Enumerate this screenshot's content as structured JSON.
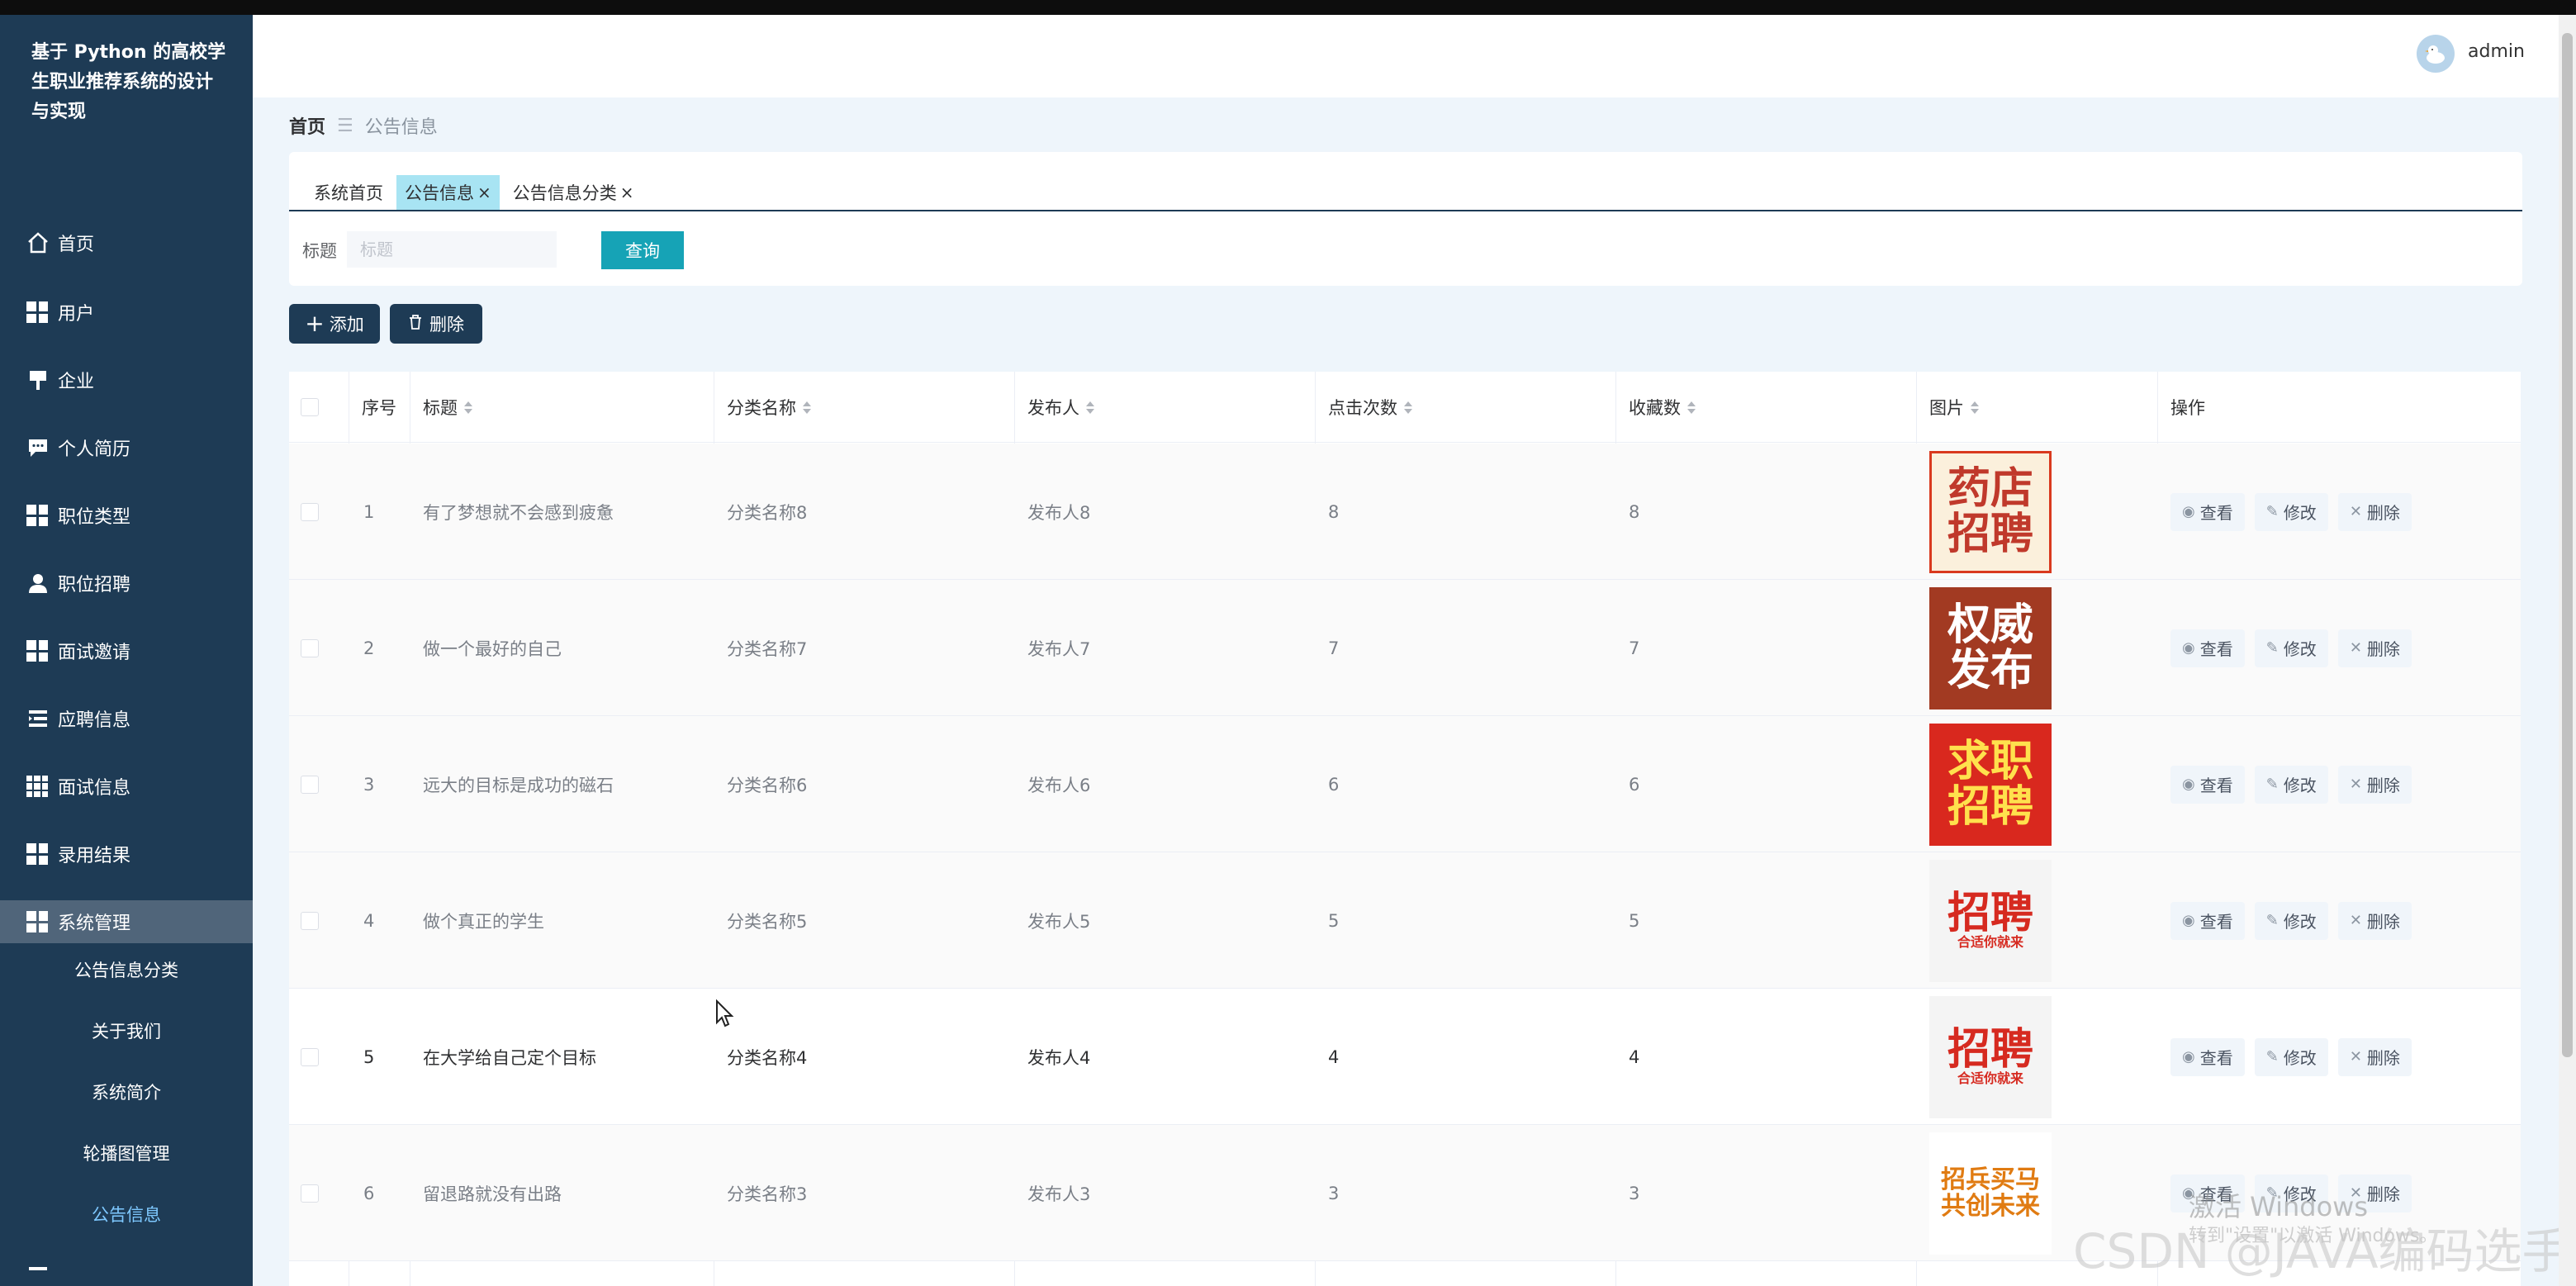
{
  "app": {
    "title": "基于 Python 的高校学生职业推荐系统的设计与实现"
  },
  "user": {
    "name": "admin"
  },
  "sidebar": {
    "items": [
      {
        "label": "首页",
        "icon": "home-icon"
      },
      {
        "label": "用户",
        "icon": "grid-icon"
      },
      {
        "label": "企业",
        "icon": "sign-icon"
      },
      {
        "label": "个人简历",
        "icon": "chat-icon"
      },
      {
        "label": "职位类型",
        "icon": "grid-icon"
      },
      {
        "label": "职位招聘",
        "icon": "person-icon"
      },
      {
        "label": "面试邀请",
        "icon": "grid-icon"
      },
      {
        "label": "应聘信息",
        "icon": "list-icon"
      },
      {
        "label": "面试信息",
        "icon": "grid9-icon"
      },
      {
        "label": "录用结果",
        "icon": "grid-icon"
      },
      {
        "label": "系统管理",
        "icon": "grid-icon"
      }
    ],
    "sub_items": [
      {
        "label": "公告信息分类"
      },
      {
        "label": "关于我们"
      },
      {
        "label": "系统简介"
      },
      {
        "label": "轮播图管理"
      },
      {
        "label": "公告信息"
      }
    ]
  },
  "breadcrumb": {
    "home": "首页",
    "current": "公告信息"
  },
  "tabs": [
    {
      "label": "系统首页",
      "closable": false
    },
    {
      "label": "公告信息",
      "closable": true,
      "active": true
    },
    {
      "label": "公告信息分类",
      "closable": true
    }
  ],
  "filter": {
    "label": "标题",
    "placeholder": "标题",
    "query_label": "查询"
  },
  "toolbar": {
    "add_label": "添加",
    "delete_label": "删除"
  },
  "table": {
    "columns": [
      "序号",
      "标题",
      "分类名称",
      "发布人",
      "点击次数",
      "收藏数",
      "图片",
      "操作"
    ],
    "rows": [
      {
        "no": "1",
        "title": "有了梦想就不会感到疲惫",
        "category": "分类名称8",
        "publisher": "发布人8",
        "clicks": "8",
        "favorites": "8",
        "image": {
          "line1": "药店",
          "line2": "招聘",
          "bg": "#fbf0dc",
          "fg": "#c0392b",
          "border": "#d9391e"
        }
      },
      {
        "no": "2",
        "title": "做一个最好的自己",
        "category": "分类名称7",
        "publisher": "发布人7",
        "clicks": "7",
        "favorites": "7",
        "image": {
          "line1": "权威",
          "line2": "发布",
          "bg": "#a23a22",
          "fg": "#ffffff",
          "border": "#a23a22"
        }
      },
      {
        "no": "3",
        "title": "远大的目标是成功的磁石",
        "category": "分类名称6",
        "publisher": "发布人6",
        "clicks": "6",
        "favorites": "6",
        "image": {
          "line1": "求职",
          "line2": "招聘",
          "bg": "#d9281e",
          "fg": "#ffe14d",
          "border": "#d9281e"
        }
      },
      {
        "no": "4",
        "title": "做个真正的学生",
        "category": "分类名称5",
        "publisher": "发布人5",
        "clicks": "5",
        "favorites": "5",
        "image": {
          "line1": "招聘",
          "line2": "合适你就来",
          "bg": "#f4f4f4",
          "fg": "#d62a20",
          "border": "#f4f4f4"
        }
      },
      {
        "no": "5",
        "title": "在大学给自己定个目标",
        "category": "分类名称4",
        "publisher": "发布人4",
        "clicks": "4",
        "favorites": "4",
        "image": {
          "line1": "招聘",
          "line2": "合适你就来",
          "bg": "#f4f4f4",
          "fg": "#d62a20",
          "border": "#f4f4f4"
        }
      },
      {
        "no": "6",
        "title": "留退路就没有出路",
        "category": "分类名称3",
        "publisher": "发布人3",
        "clicks": "3",
        "favorites": "3",
        "image": {
          "line1": "招兵买马",
          "line2": "共创未来",
          "bg": "#ffffff",
          "fg": "#e07b12",
          "border": "#ffffff"
        }
      }
    ],
    "actions": {
      "view": "查看",
      "edit": "修改",
      "delete": "删除"
    }
  },
  "overlay": {
    "activation_title": "激活 Windows",
    "activation_sub": "转到\"设置\"以激活 Windows。",
    "watermark": "CSDN @JAVA编码选手"
  },
  "colors": {
    "sidebar_bg": "#1e3b55",
    "accent": "#16a3b6",
    "active_tab": "#a8e4f3",
    "page_bg": "#eef5fb"
  }
}
